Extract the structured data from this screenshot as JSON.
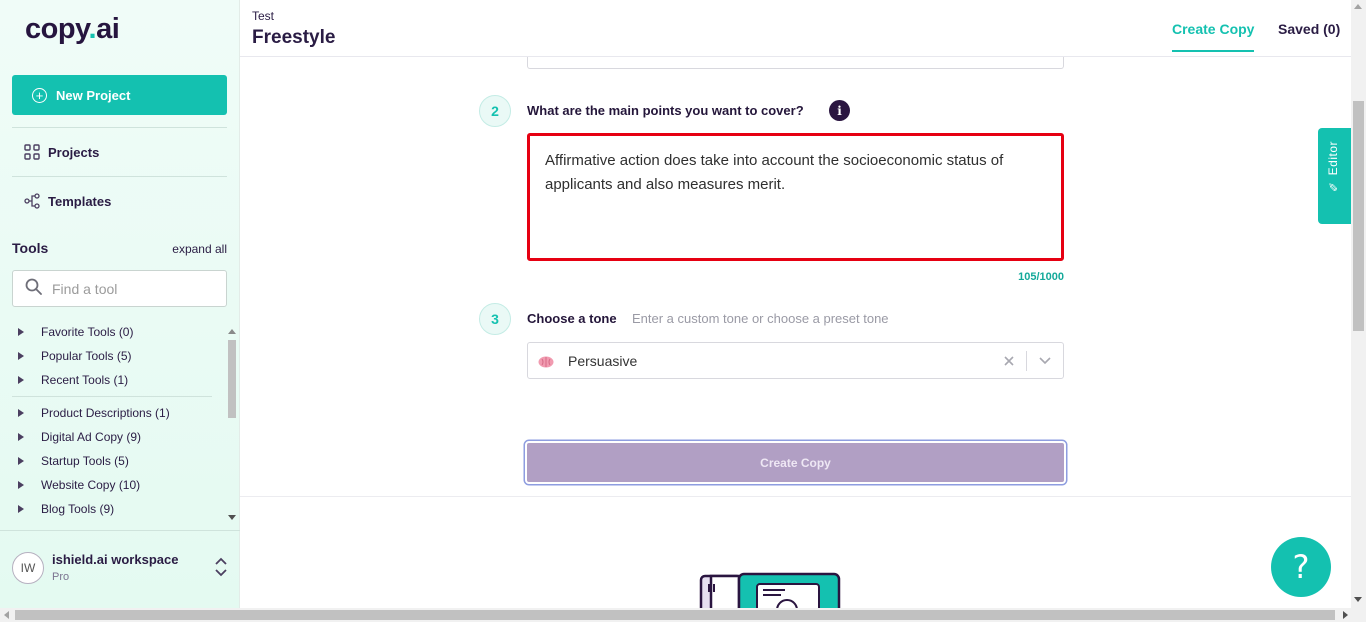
{
  "app": {
    "logo_text": "copy",
    "logo_dot": ".",
    "logo_suffix": "ai",
    "accent_color": "#14c1b0"
  },
  "sidebar": {
    "new_project_label": "New Project",
    "nav": [
      {
        "label": "Projects",
        "icon": "grid-icon"
      },
      {
        "label": "Templates",
        "icon": "share-nodes-icon"
      }
    ],
    "tools_title": "Tools",
    "expand_all": "expand all",
    "search_placeholder": "Find a tool",
    "tool_groups": [
      {
        "label": "Favorite Tools (0)"
      },
      {
        "label": "Popular Tools (5)"
      },
      {
        "label": "Recent Tools (1)"
      },
      {
        "label": "Product Descriptions (1)"
      },
      {
        "label": "Digital Ad Copy (9)"
      },
      {
        "label": "Startup Tools (5)"
      },
      {
        "label": "Website Copy (10)"
      },
      {
        "label": "Blog Tools (9)"
      }
    ],
    "workspace": {
      "initials": "IW",
      "name": "ishield.ai workspace",
      "plan": "Pro"
    }
  },
  "header": {
    "project": "Test",
    "title": "Freestyle",
    "tabs": [
      {
        "label": "Create Copy",
        "active": true
      },
      {
        "label": "Saved (0)",
        "active": false
      }
    ]
  },
  "form": {
    "step2": {
      "number": "2",
      "label": "What are the main points you want to cover?",
      "info": "i",
      "value": "Affirmative action does take into account the socioeconomic status of applicants and also measures merit.",
      "counter": "105/1000"
    },
    "step3": {
      "number": "3",
      "label": "Choose a tone",
      "hint": "Enter a custom tone or choose a preset tone",
      "selected": "Persuasive",
      "selected_icon": "brain-icon"
    },
    "submit_label": "Create Copy"
  },
  "editor_tab": "Editor",
  "help_label": "?"
}
